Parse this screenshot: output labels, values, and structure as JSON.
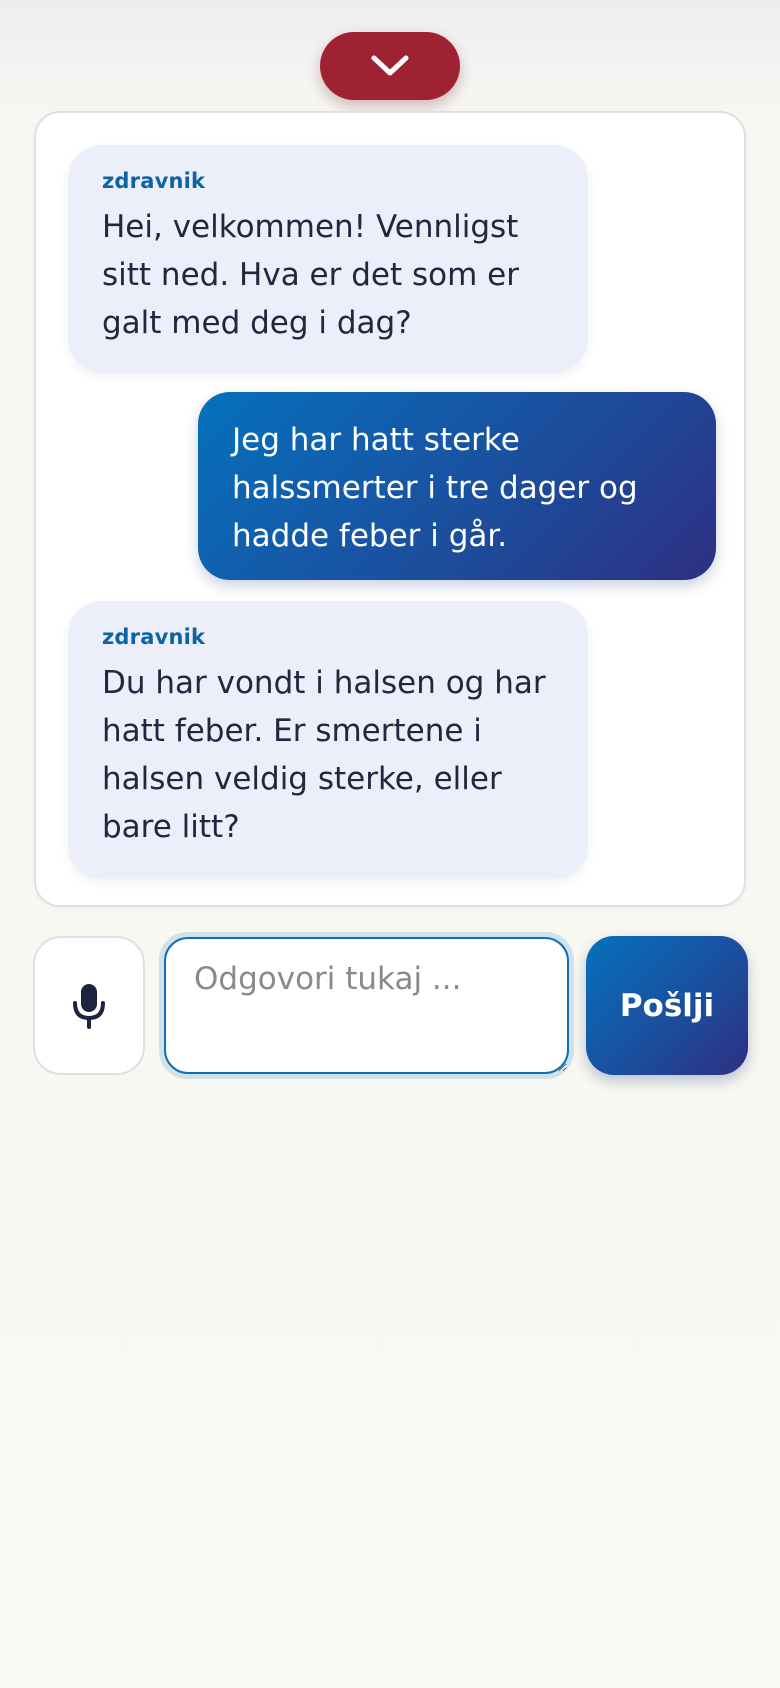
{
  "header": {
    "collapse_icon": "chevron-down-icon",
    "collapse_color": "#9f2233"
  },
  "chat": {
    "messages": [
      {
        "role": "assistant",
        "sender": "zdravnik",
        "text": "Hei, velkommen! Vennligst sitt ned. Hva er det som er galt med deg i dag?"
      },
      {
        "role": "user",
        "text": "Jeg har hatt sterke halssmerter i tre dager og hadde feber i går."
      },
      {
        "role": "assistant",
        "sender": "zdravnik",
        "text": "Du har vondt i halsen og har hatt feber. Er smertene i halsen veldig sterke, eller bare litt?"
      }
    ]
  },
  "composer": {
    "mic_icon": "microphone-icon",
    "placeholder": "Odgovori tukaj ...",
    "value": "",
    "send_label": "Pošlji"
  },
  "colors": {
    "accent": "#0571bd",
    "accent_dark": "#2e2f82",
    "sender_label": "#0d64a5",
    "assistant_bubble": "#eceef9"
  }
}
